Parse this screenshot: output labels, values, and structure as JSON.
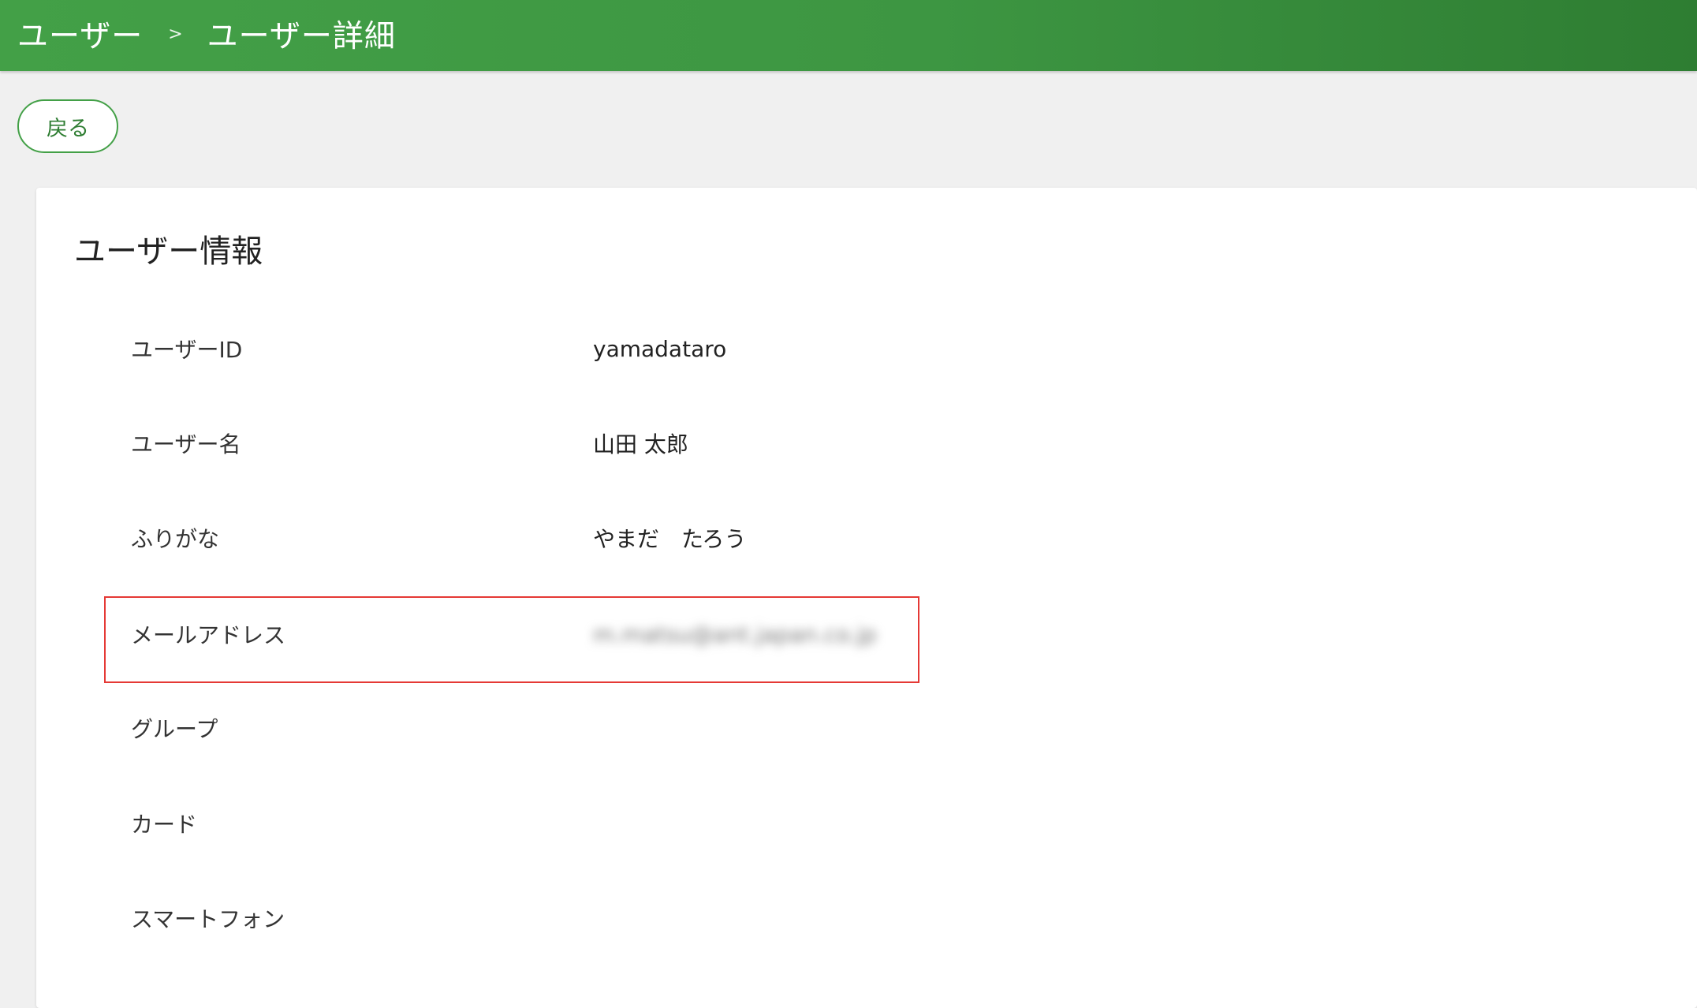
{
  "header": {
    "breadcrumb": [
      "ユーザー",
      "ユーザー詳細"
    ],
    "separator": ">"
  },
  "back_button": {
    "label": "戻る"
  },
  "card": {
    "title": "ユーザー情報",
    "fields": [
      {
        "label": "ユーザーID",
        "value": "yamadataro"
      },
      {
        "label": "ユーザー名",
        "value": "山田 太郎"
      },
      {
        "label": "ふりがな",
        "value": "やまだ　たろう"
      },
      {
        "label": "メールアドレス",
        "value": "m.matsu@ant.japan.co.jp"
      },
      {
        "label": "グループ",
        "value": ""
      },
      {
        "label": "カード",
        "value": ""
      },
      {
        "label": "スマートフォン",
        "value": ""
      }
    ]
  },
  "colors": {
    "header_green": "#43a047",
    "highlight_red": "#e53935"
  }
}
